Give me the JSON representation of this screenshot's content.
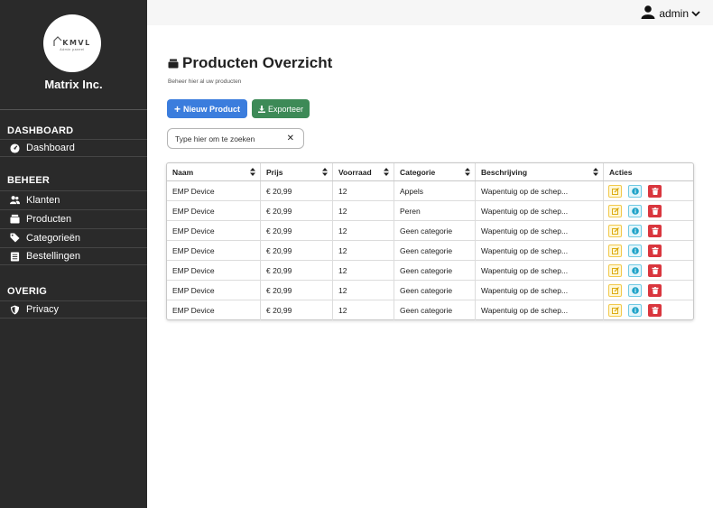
{
  "sidebar": {
    "logo": {
      "text": "KMVL",
      "sub": "Admin paneel"
    },
    "brand": "Matrix Inc.",
    "sections": [
      {
        "title": "DASHBOARD",
        "items": [
          {
            "label": "Dashboard",
            "icon": "dashboard-icon"
          }
        ]
      },
      {
        "title": "BEHEER",
        "items": [
          {
            "label": "Klanten",
            "icon": "users-icon"
          },
          {
            "label": "Producten",
            "icon": "box-icon"
          },
          {
            "label": "Categorieën",
            "icon": "tag-icon"
          },
          {
            "label": "Bestellingen",
            "icon": "receipt-icon"
          }
        ]
      },
      {
        "title": "OVERIG",
        "items": [
          {
            "label": "Privacy",
            "icon": "shield-icon"
          }
        ]
      }
    ]
  },
  "topbar": {
    "user": "admin"
  },
  "main": {
    "title": "Producten Overzicht",
    "subtitle": "Beheer hier al uw producten",
    "new_button": "Nieuw Product",
    "export_button": "Exporteer",
    "search_placeholder": "Type hier om te zoeken"
  },
  "table": {
    "columns": [
      "Naam",
      "Prijs",
      "Voorraad",
      "Categorie",
      "Beschrijving",
      "Acties"
    ],
    "rows": [
      [
        "EMP Device",
        "€ 20,99",
        "12",
        "Appels",
        "Wapentuig op de schep..."
      ],
      [
        "EMP Device",
        "€ 20,99",
        "12",
        "Peren",
        "Wapentuig op de schep..."
      ],
      [
        "EMP Device",
        "€ 20,99",
        "12",
        "Geen categorie",
        "Wapentuig op de schep..."
      ],
      [
        "EMP Device",
        "€ 20,99",
        "12",
        "Geen categorie",
        "Wapentuig op de schep..."
      ],
      [
        "EMP Device",
        "€ 20,99",
        "12",
        "Geen categorie",
        "Wapentuig op de schep..."
      ],
      [
        "EMP Device",
        "€ 20,99",
        "12",
        "Geen categorie",
        "Wapentuig op de schep..."
      ],
      [
        "EMP Device",
        "€ 20,99",
        "12",
        "Geen categorie",
        "Wapentuig op de schep..."
      ]
    ]
  },
  "colors": {
    "sidebar_bg": "#2a2a2a",
    "primary": "#3b7ddd",
    "success": "#3d8a57",
    "edit": "#f2c94c",
    "info": "#6ec9e3",
    "danger": "#d9363e"
  }
}
